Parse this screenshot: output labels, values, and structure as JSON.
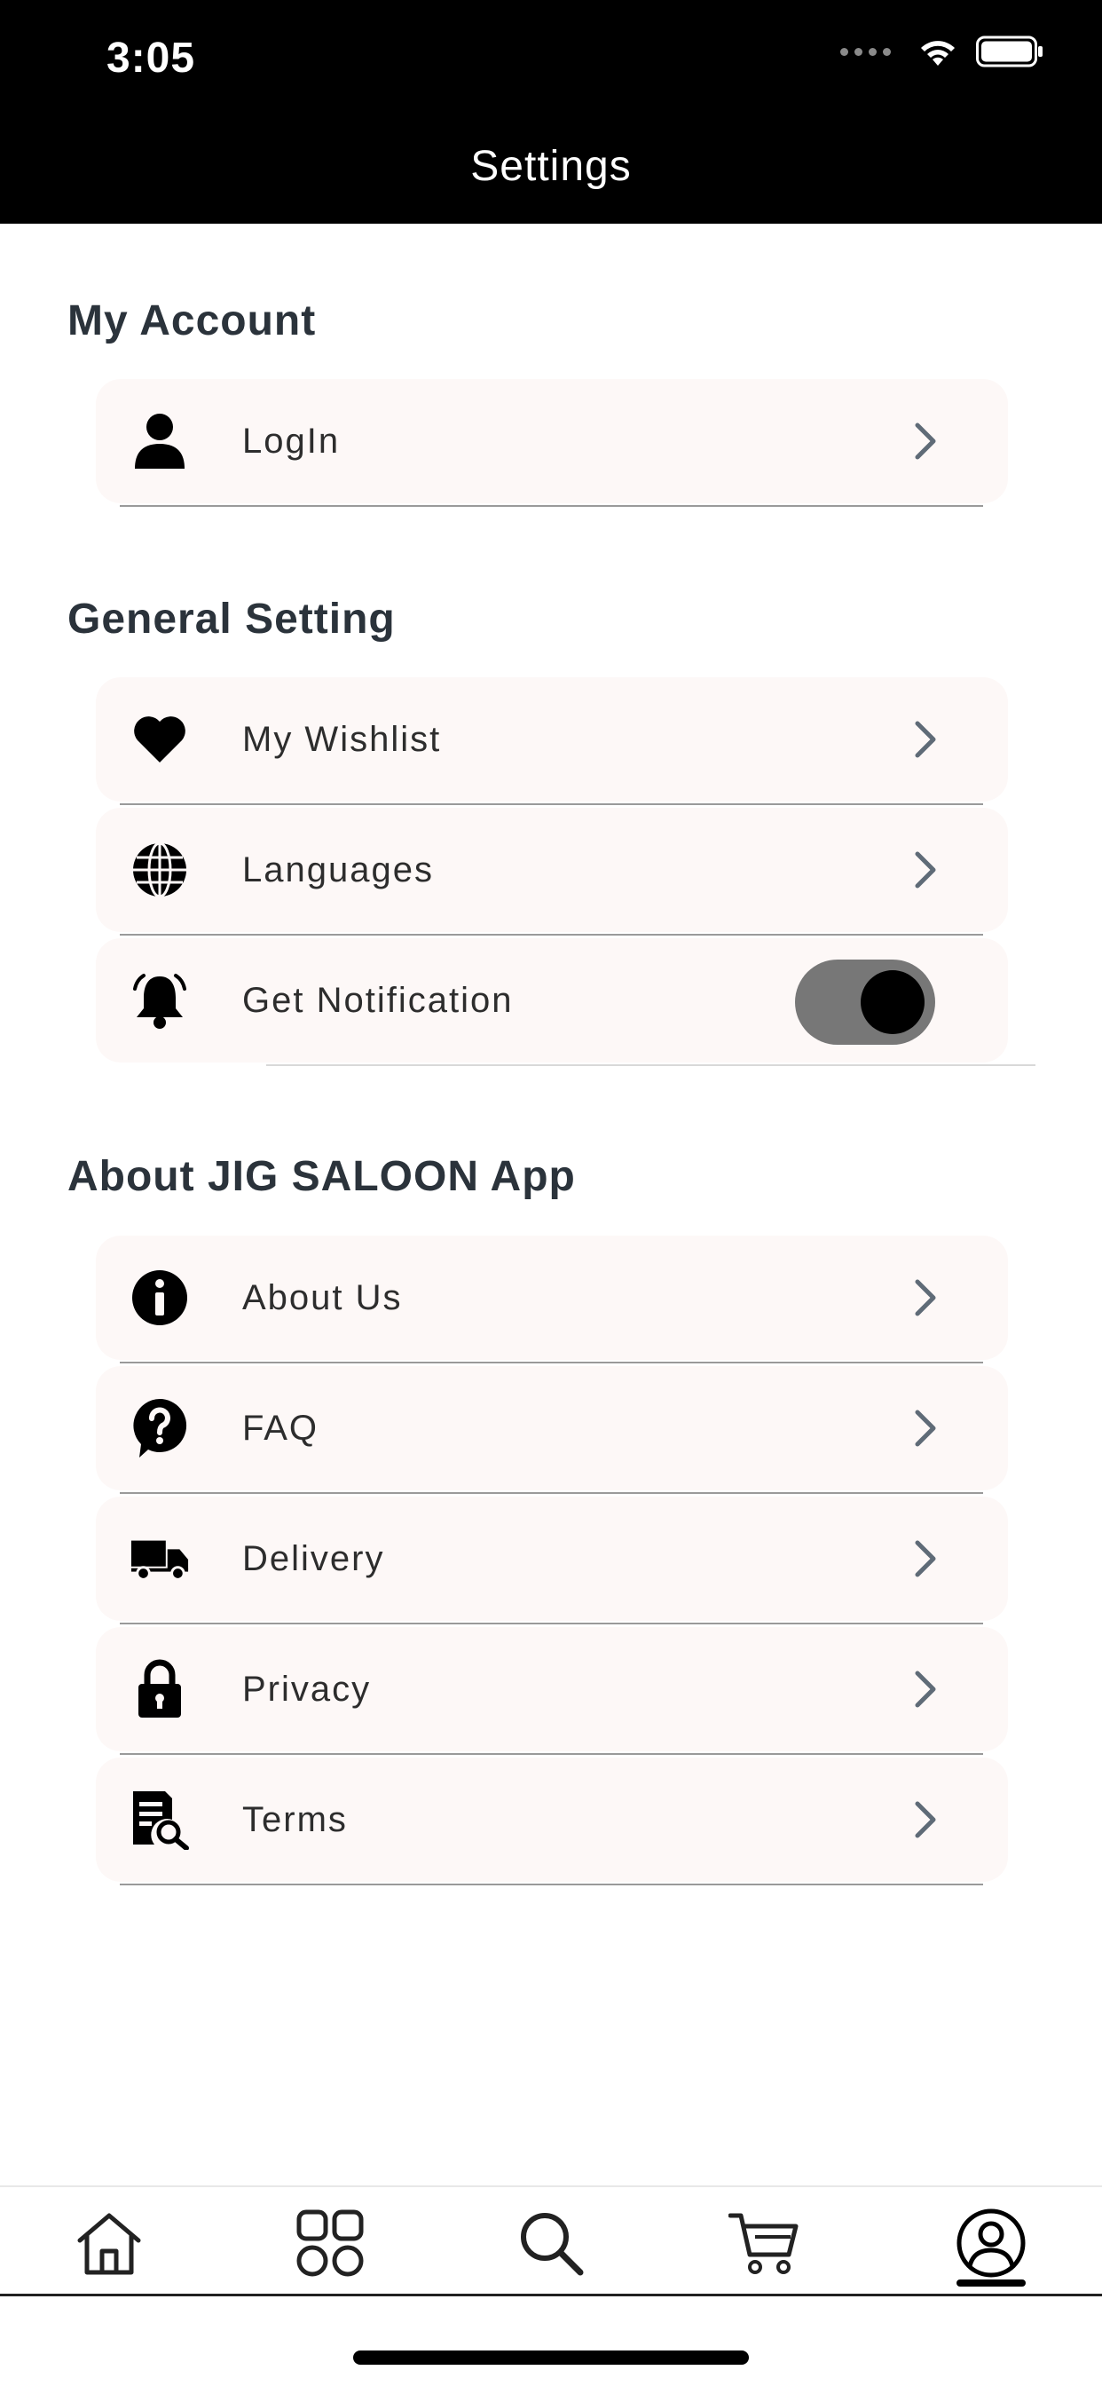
{
  "status_bar": {
    "time": "3:05"
  },
  "header": {
    "title": "Settings"
  },
  "sections": {
    "account": {
      "title": "My Account",
      "items": [
        {
          "label": "LogIn",
          "icon": "user-icon"
        }
      ]
    },
    "general": {
      "title": "General Setting",
      "items": [
        {
          "label": "My Wishlist",
          "icon": "heart-icon"
        },
        {
          "label": "Languages",
          "icon": "globe-icon"
        },
        {
          "label": "Get Notification",
          "icon": "bell-icon",
          "toggle_on": true
        }
      ]
    },
    "about": {
      "title": "About JIG SALOON App",
      "items": [
        {
          "label": "About Us",
          "icon": "info-icon"
        },
        {
          "label": "FAQ",
          "icon": "question-icon"
        },
        {
          "label": "Delivery",
          "icon": "truck-icon"
        },
        {
          "label": "Privacy",
          "icon": "lock-icon"
        },
        {
          "label": "Terms",
          "icon": "document-search-icon"
        }
      ]
    }
  },
  "bottom_nav": {
    "items": [
      {
        "icon": "home-icon"
      },
      {
        "icon": "categories-icon"
      },
      {
        "icon": "search-icon"
      },
      {
        "icon": "cart-icon"
      },
      {
        "icon": "profile-icon",
        "active": true
      }
    ]
  },
  "colors": {
    "header_bg": "#000000",
    "row_bg": "#fdf8f7",
    "section_title": "#2b333b",
    "chevron": "#5f6b77",
    "toggle_track": "#777777"
  }
}
